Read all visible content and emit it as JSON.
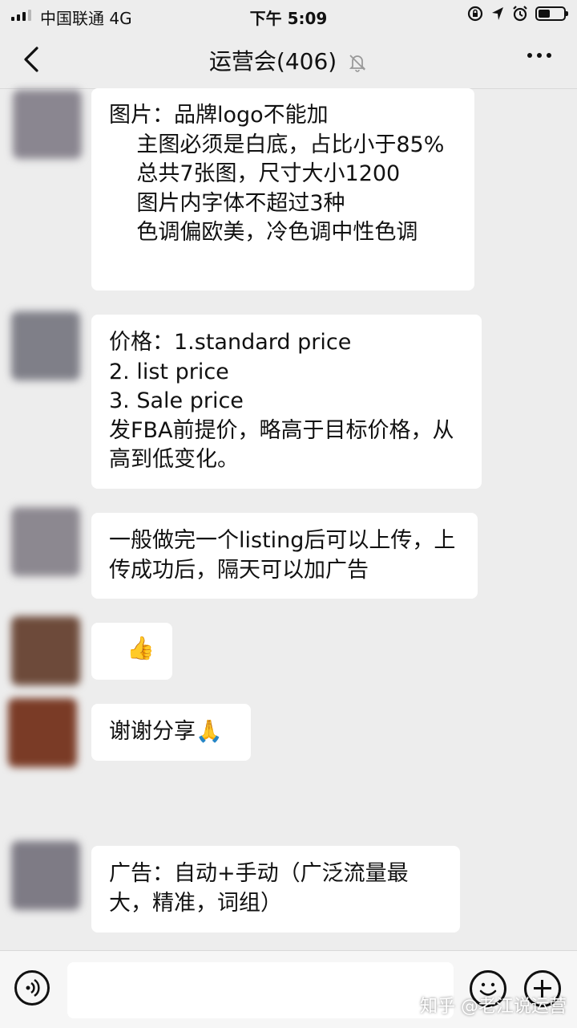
{
  "status_bar": {
    "carrier": "中国联通  4G",
    "time": "下午 5:09"
  },
  "nav": {
    "title": "运营会(406)"
  },
  "messages": [
    {
      "avatar_color": "#8a8690",
      "text": "图片：品牌logo不能加\n    主图必须是白底，占比小于85%\n    总共7张图，尺寸大小1200\n    图片内字体不超过3种\n    色调偏欧美，冷色调中性色调"
    },
    {
      "avatar_color": "#7f7f88",
      "text": "价格：1.standard price\n2. list price\n3. Sale price\n发FBA前提价，略高于目标价格，从高到低变化。"
    },
    {
      "avatar_color": "#8c8890",
      "text": "一般做完一个listing后可以上传，上传成功后，隔天可以加广告"
    },
    {
      "avatar_color": "#6d4a3a",
      "text": "👍"
    },
    {
      "avatar_color": "#7a3b26",
      "text": "谢谢分享🙏"
    },
    {
      "avatar_color": "#7e7b85",
      "text": "广告：自动+手动（广泛流量最大，精准，词组）"
    }
  ],
  "input": {
    "placeholder": ""
  },
  "watermark": "知乎 @老江说运营"
}
